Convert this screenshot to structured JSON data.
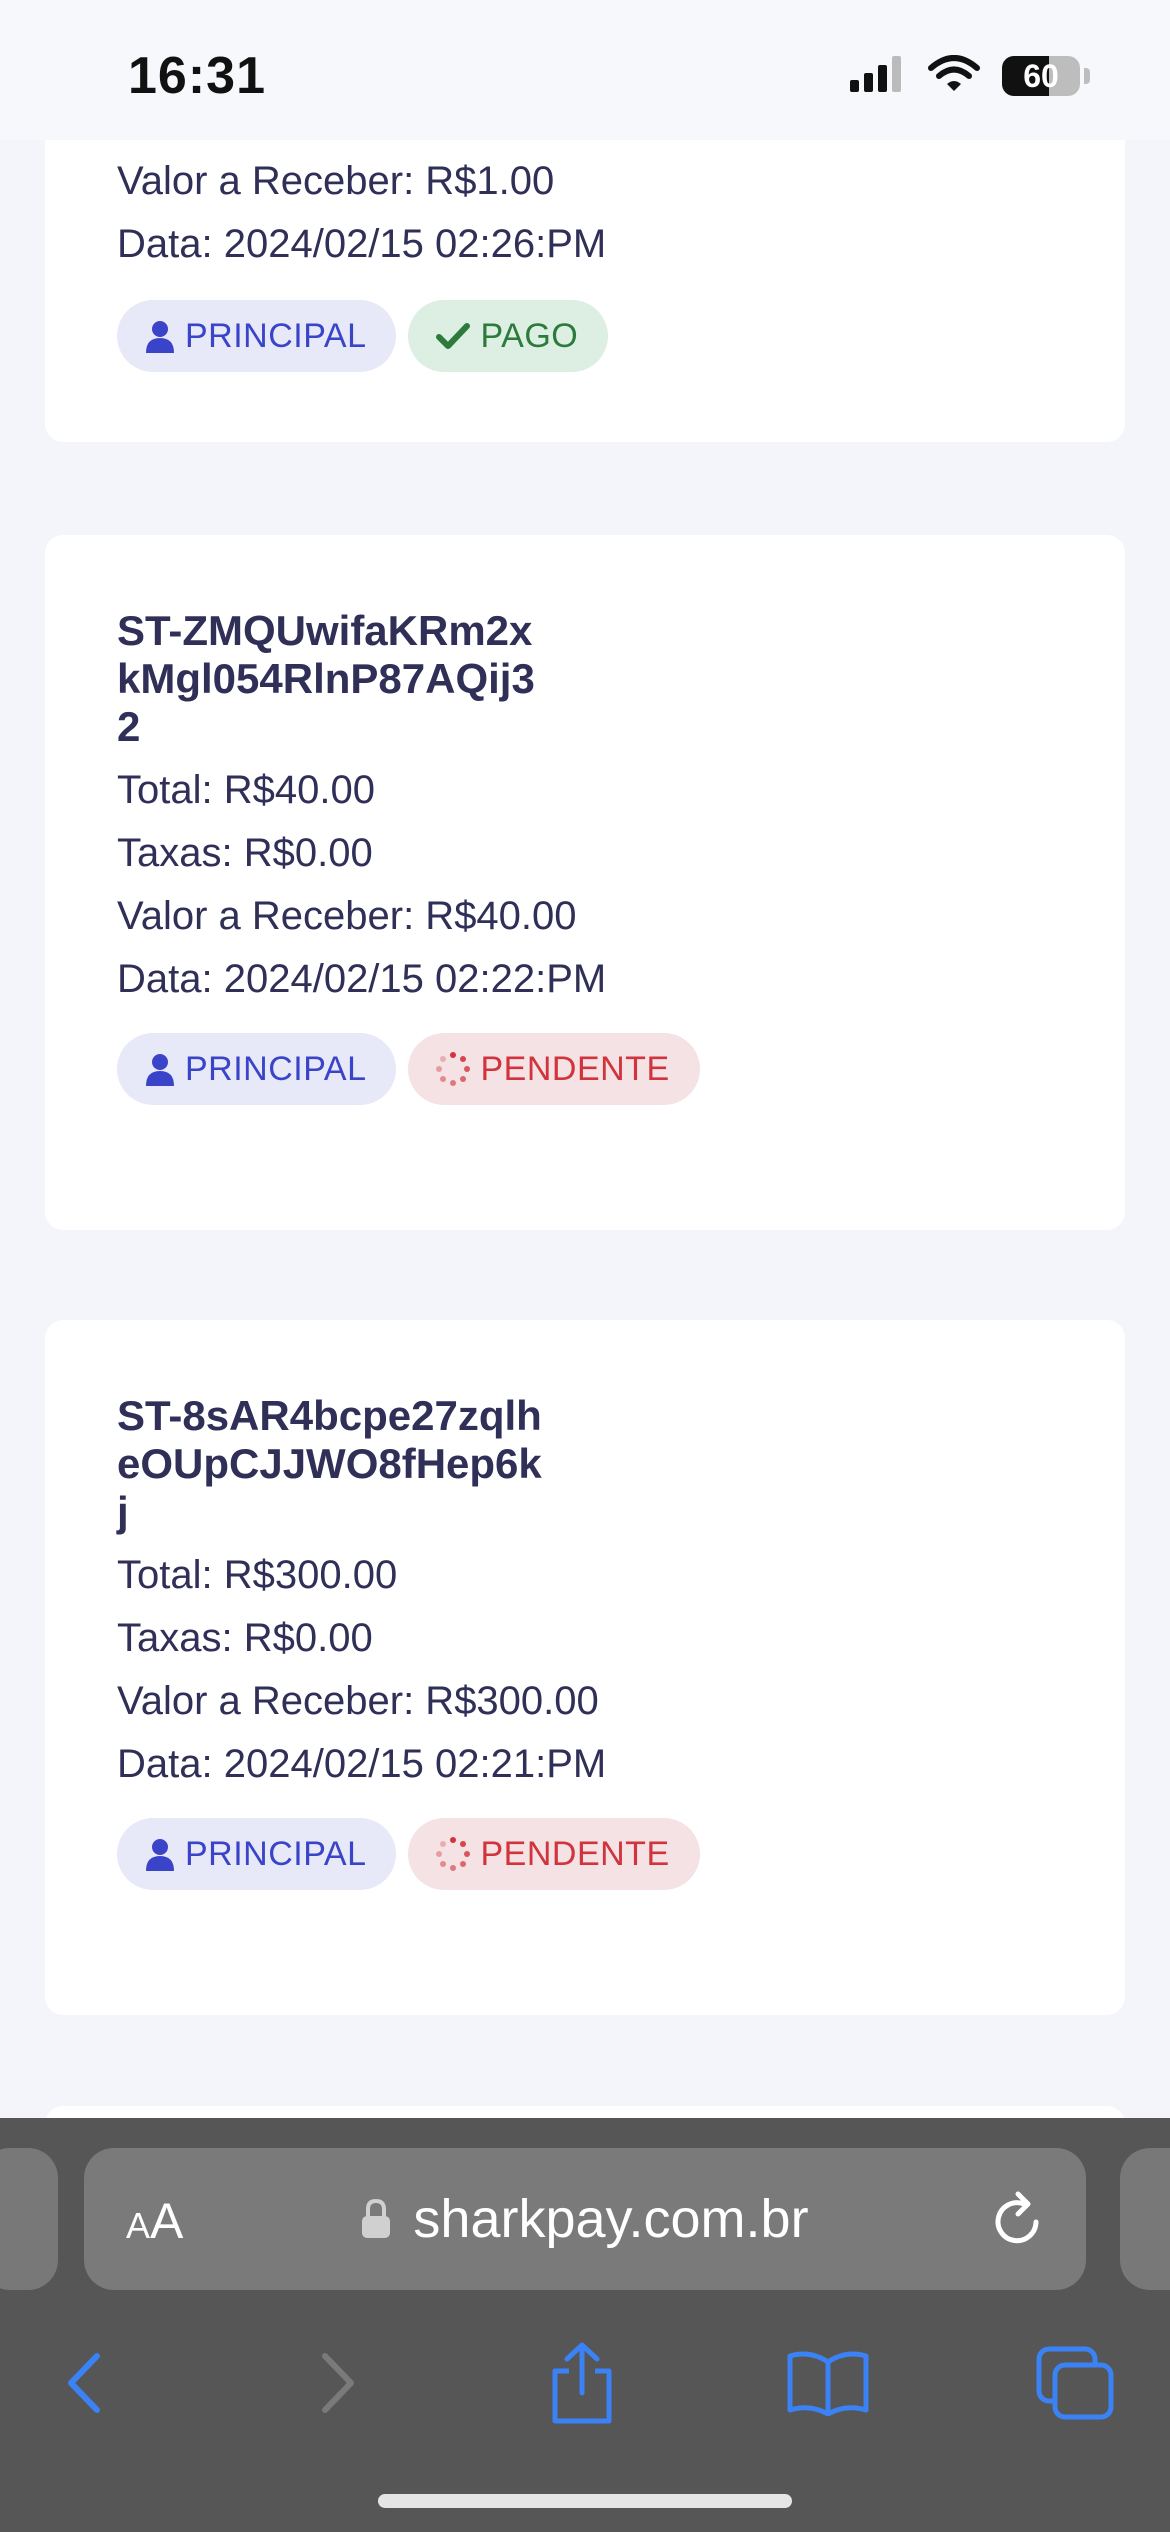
{
  "status": {
    "time": "16:31",
    "battery": "60"
  },
  "cards": [
    {
      "valor_receber": "Valor a Receber: R$1.00",
      "data": "Data: 2024/02/15 02:26:PM",
      "tag_account": "PRINCIPAL",
      "tag_status": "PAGO"
    },
    {
      "id": "ST-ZMQUwifaKRm2xkMgl054RlnP87AQij32",
      "total": "Total: R$40.00",
      "taxas": "Taxas: R$0.00",
      "valor_receber": "Valor a Receber: R$40.00",
      "data": "Data: 2024/02/15 02:22:PM",
      "tag_account": "PRINCIPAL",
      "tag_status": "PENDENTE"
    },
    {
      "id": "ST-8sAR4bcpe27zqlheOUpCJJWO8fHep6kj",
      "total": "Total: R$300.00",
      "taxas": "Taxas: R$0.00",
      "valor_receber": "Valor a Receber: R$300.00",
      "data": "Data: 2024/02/15 02:21:PM",
      "tag_account": "PRINCIPAL",
      "tag_status": "PENDENTE"
    }
  ],
  "browser": {
    "text_size_small": "A",
    "text_size_large": "A",
    "url": "sharkpay.com.br"
  },
  "colors": {
    "principal": "#3a44c9",
    "pago": "#2c7a3c",
    "pendente": "#d1343c",
    "toolbar_accent": "#3b82f6"
  },
  "icons": [
    "signal-icon",
    "wifi-icon",
    "battery-icon",
    "user-icon",
    "check-icon",
    "loading-icon",
    "lock-icon",
    "reload-icon",
    "back-icon",
    "forward-icon",
    "share-icon",
    "bookmarks-icon",
    "tabs-icon"
  ]
}
